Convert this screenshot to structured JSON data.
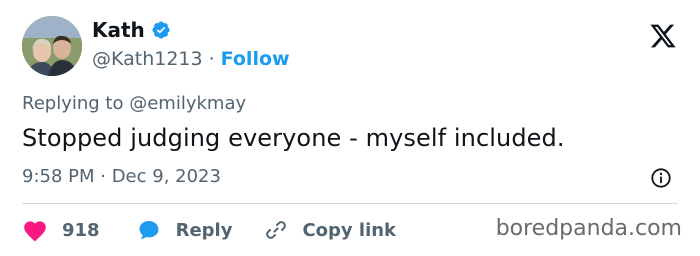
{
  "author": {
    "display_name": "Kath",
    "handle": "@Kath1213",
    "separator": "·",
    "follow_label": "Follow",
    "verified_color": "#1d9bf0"
  },
  "tweet": {
    "reply_prefix": "Replying to",
    "reply_mention": "@emilykmay",
    "text": "Stopped judging everyone - myself included.",
    "timestamp": "9:58 PM · Dec 9, 2023"
  },
  "actions": {
    "like_count": "918",
    "reply_label": "Reply",
    "copy_label": "Copy link"
  },
  "watermark": "boredpanda.com",
  "colors": {
    "accent": "#1d9bf0",
    "like": "#f91880",
    "muted": "#536471",
    "text": "#0f1419"
  },
  "icons": [
    "verified-badge-icon",
    "x-logo-icon",
    "info-icon",
    "heart-icon",
    "reply-bubble-icon",
    "link-icon"
  ]
}
